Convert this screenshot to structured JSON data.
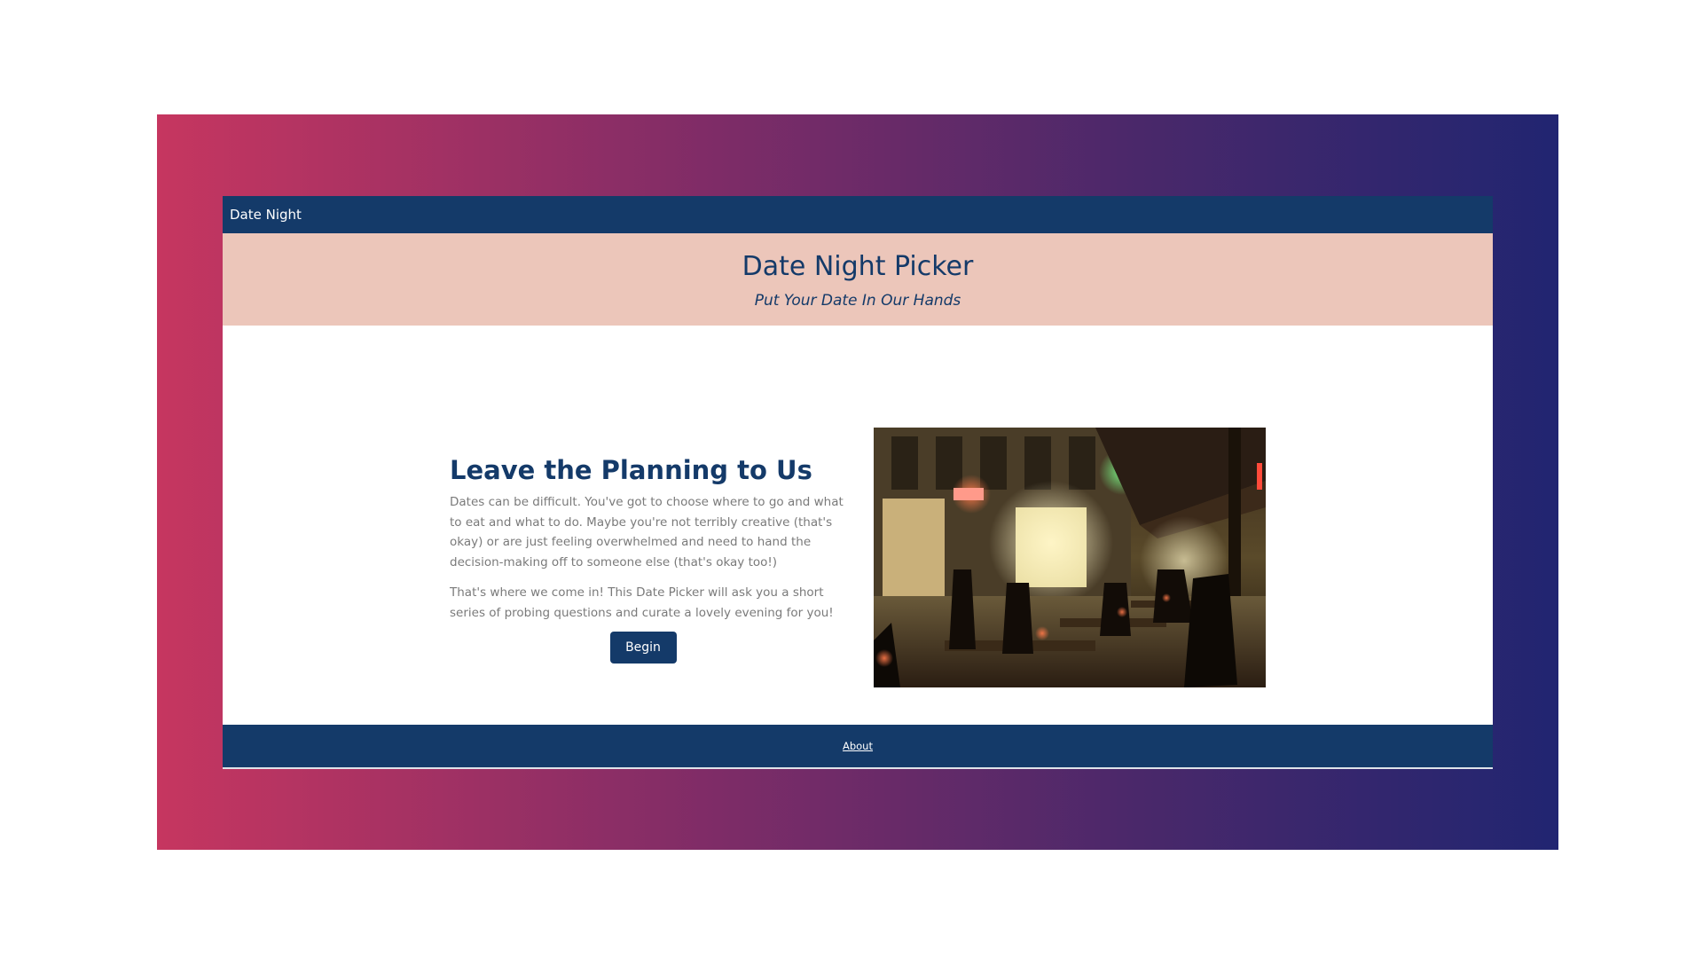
{
  "navbar": {
    "brand_label": "Date Night"
  },
  "hero": {
    "title": "Date Night Picker",
    "subtitle": "Put Your Date In Our Hands"
  },
  "content": {
    "heading": "Leave the Planning to Us",
    "paragraph_1": "Dates can be difficult. You've got to choose where to go and what to eat and what to do. Maybe you're not terribly creative (that's okay) or are just feeling overwhelmed and need to hand the decision-making off to someone else (that's okay too!)",
    "paragraph_2": "That's where we come in! This Date Picker will ask you a short series of probing questions and curate a lovely evening for you!",
    "begin_label": "Begin"
  },
  "footer": {
    "about_label": "About"
  },
  "colors": {
    "navy": "#143a69",
    "hero_bg": "#ecc6ba",
    "gradient_start": "#c63660",
    "gradient_end": "#212571"
  }
}
